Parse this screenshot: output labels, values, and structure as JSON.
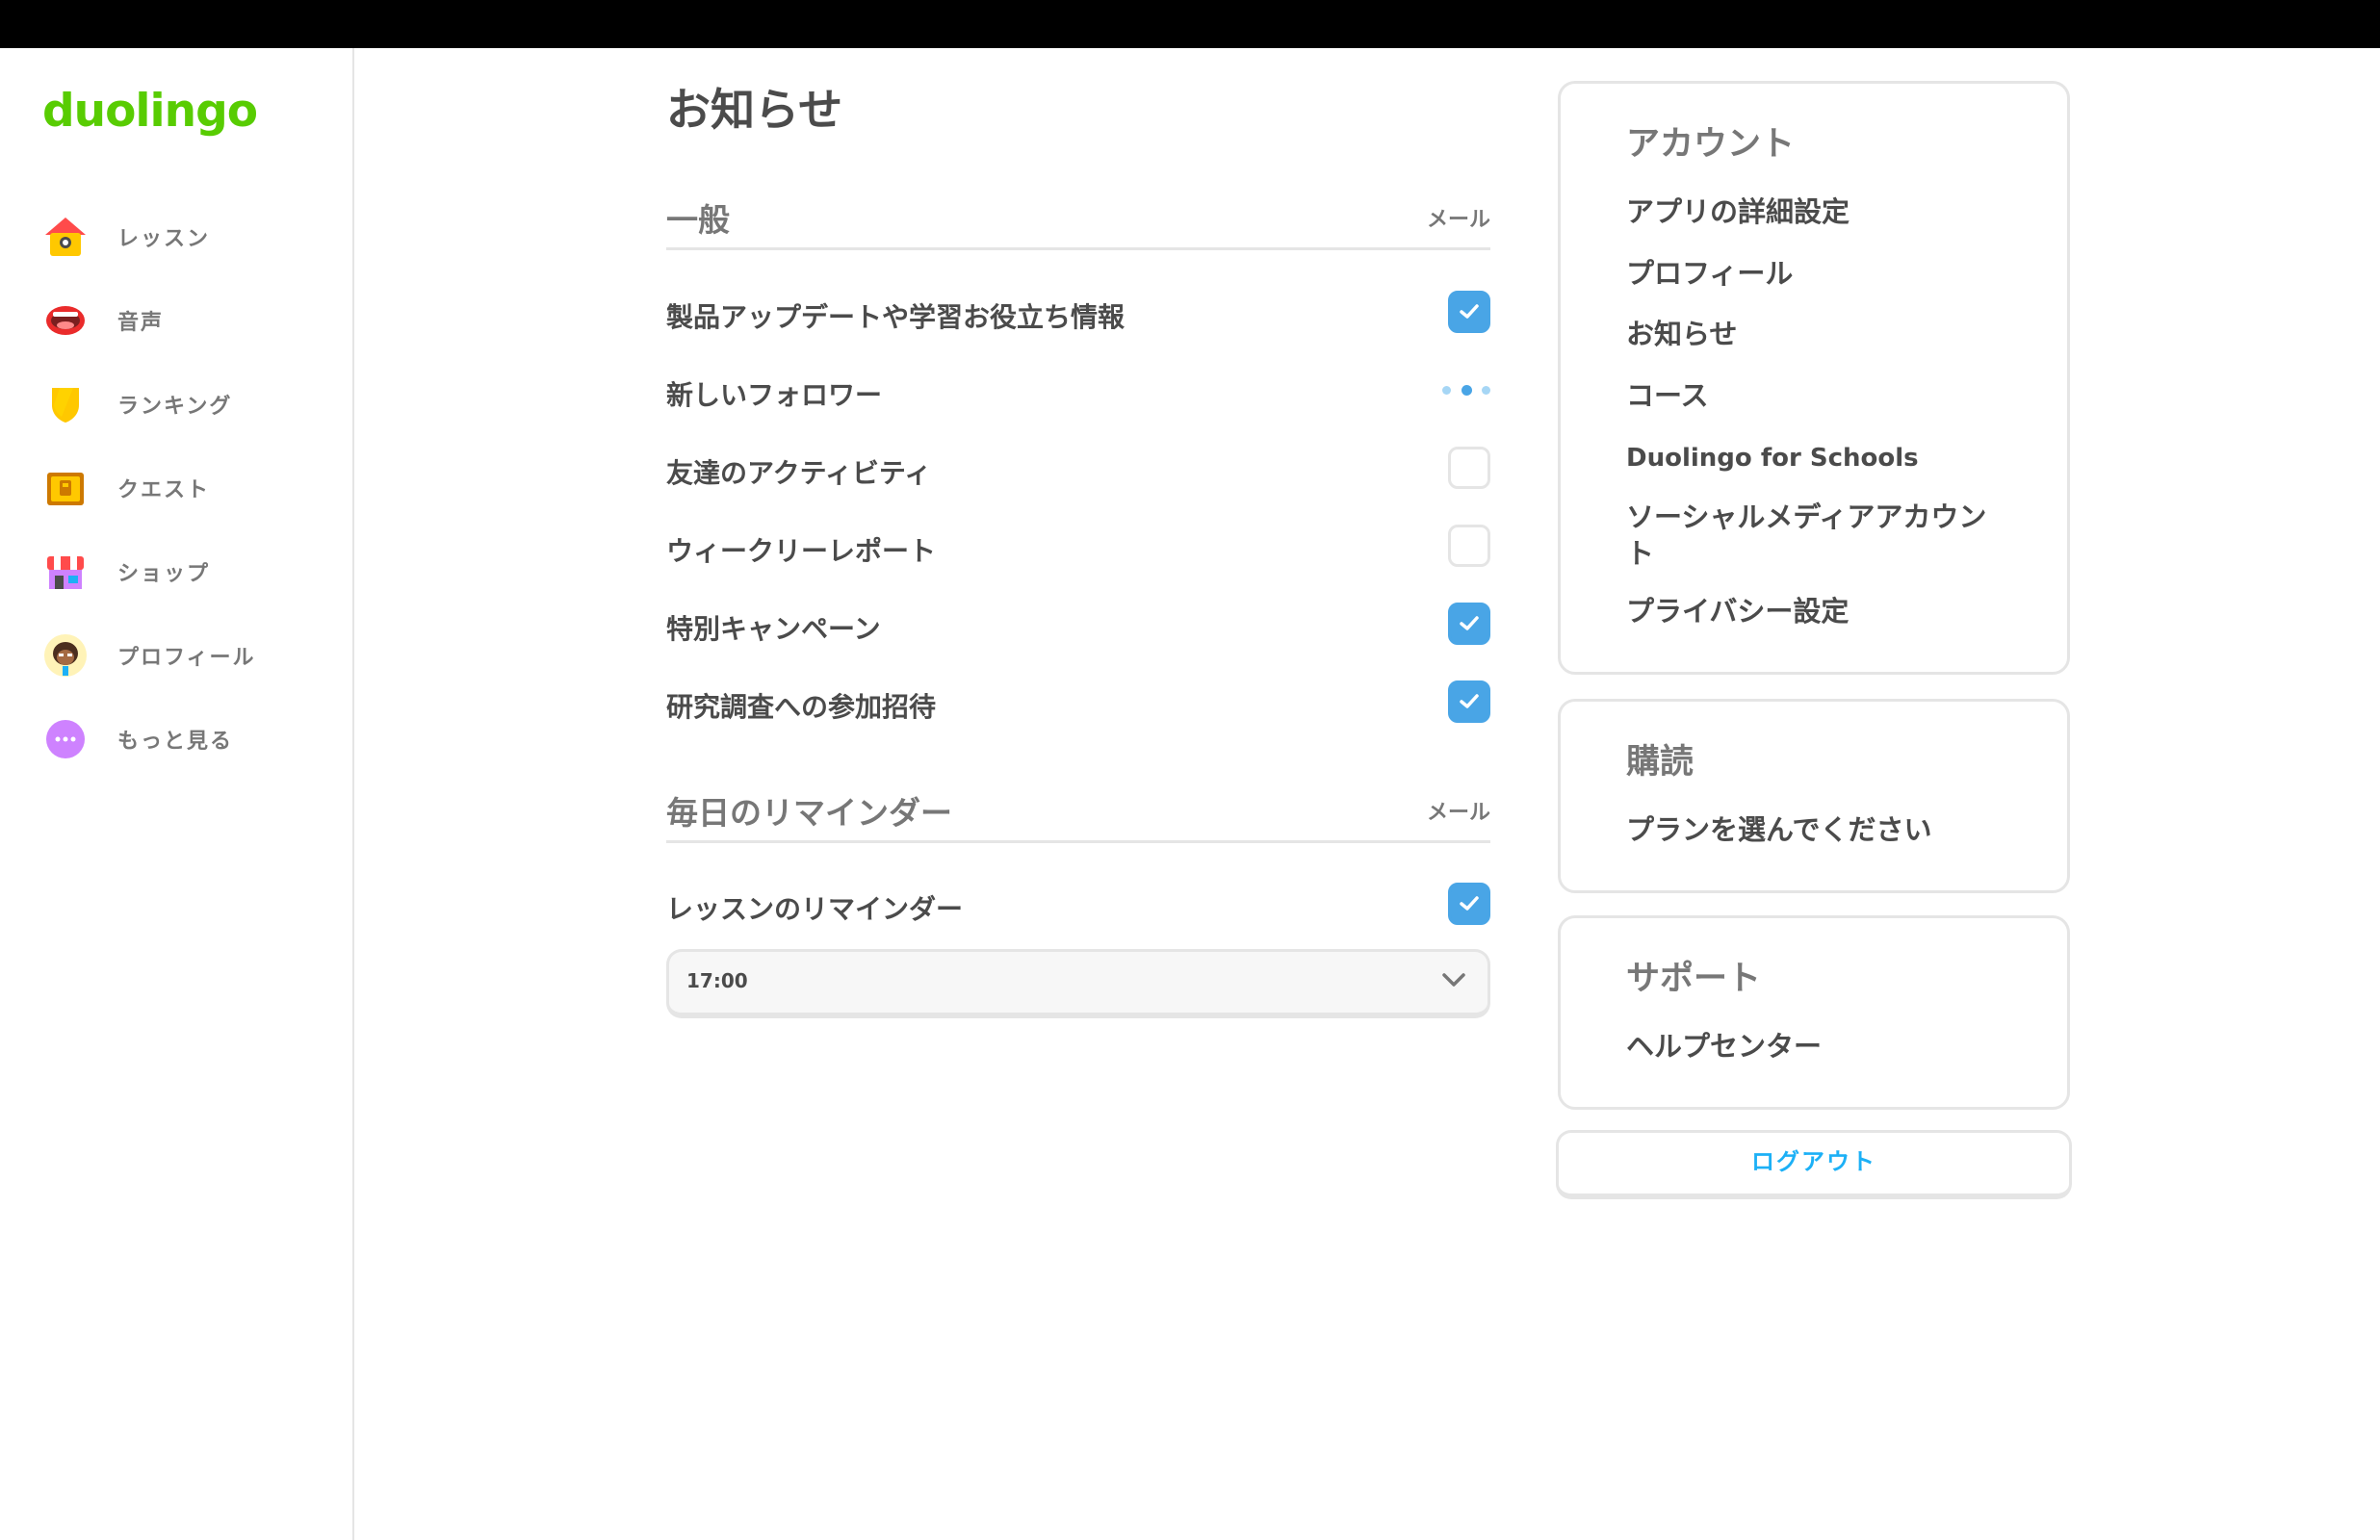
{
  "app": {
    "logo": "duolingo",
    "brand_color": "#58cc02",
    "accent_color": "#49a5e6"
  },
  "sidebar": {
    "items": [
      {
        "label": "レッスン",
        "icon": "house-icon"
      },
      {
        "label": "音声",
        "icon": "mouth-icon"
      },
      {
        "label": "ランキング",
        "icon": "shield-icon"
      },
      {
        "label": "クエスト",
        "icon": "treasure-chest-icon"
      },
      {
        "label": "ショップ",
        "icon": "shop-icon"
      },
      {
        "label": "プロフィール",
        "icon": "avatar-icon"
      },
      {
        "label": "もっと見る",
        "icon": "more-icon"
      }
    ]
  },
  "main": {
    "title": "お知らせ",
    "general": {
      "title": "一般",
      "column": "メール",
      "rows": [
        {
          "label": "製品アップデートや学習お役立ち情報",
          "state": "checked"
        },
        {
          "label": "新しいフォロワー",
          "state": "loading"
        },
        {
          "label": "友達のアクティビティ",
          "state": "unchecked"
        },
        {
          "label": "ウィークリーレポート",
          "state": "unchecked"
        },
        {
          "label": "特別キャンペーン",
          "state": "checked"
        },
        {
          "label": "研究調査への参加招待",
          "state": "checked"
        }
      ]
    },
    "daily": {
      "title": "毎日のリマインダー",
      "column": "メール",
      "rows": [
        {
          "label": "レッスンのリマインダー",
          "state": "checked"
        }
      ],
      "time_select": {
        "value": "17:00"
      }
    }
  },
  "right_panel": {
    "account": {
      "title": "アカウント",
      "links": [
        "アプリの詳細設定",
        "プロフィール",
        "お知らせ",
        "コース",
        "Duolingo for Schools",
        "ソーシャルメディアアカウント",
        "プライバシー設定"
      ]
    },
    "subscription": {
      "title": "購読",
      "links": [
        "プランを選んでください"
      ]
    },
    "support": {
      "title": "サポート",
      "links": [
        "ヘルプセンター"
      ]
    },
    "logout_label": "ログアウト"
  }
}
